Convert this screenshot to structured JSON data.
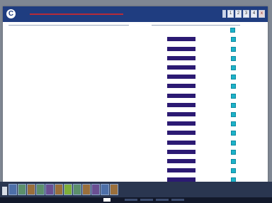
{
  "window": {
    "app_glyph": "C",
    "title_label": "",
    "title_buttons": [
      "",
      "1",
      "2",
      "3",
      "4",
      "x"
    ]
  },
  "header": {
    "label": "",
    "value": "",
    "check_color": "#1db2c9"
  },
  "rows": [
    {
      "label": "",
      "bar_text": "",
      "unit": "",
      "checked": true
    },
    {
      "label": "",
      "bar_text": "",
      "unit": "",
      "checked": true
    },
    {
      "label": "",
      "bar_text": "",
      "unit": "",
      "checked": true
    },
    {
      "label": "",
      "bar_text": "",
      "unit": "",
      "checked": true
    },
    {
      "label": "",
      "bar_text": "",
      "unit": "",
      "checked": true
    },
    {
      "label": "",
      "bar_text": "",
      "unit": "",
      "checked": true
    },
    {
      "label": "",
      "bar_text": "",
      "unit": "",
      "checked": true
    },
    {
      "label": "",
      "bar_text": "",
      "unit": "",
      "checked": true
    },
    {
      "label": "",
      "bar_text": "",
      "unit": "",
      "checked": true
    },
    {
      "label": "",
      "bar_text": "",
      "unit": "",
      "checked": true
    },
    {
      "label": "",
      "bar_text": "",
      "unit": "",
      "checked": true
    },
    {
      "label": "",
      "bar_text": "",
      "unit": "",
      "checked": true
    },
    {
      "label": "",
      "bar_text": "",
      "unit": "",
      "checked": true
    },
    {
      "label": "",
      "bar_text": "",
      "unit": "",
      "checked": true
    },
    {
      "label": "",
      "bar_text": "",
      "unit": "",
      "checked": true
    },
    {
      "label": "",
      "bar_text": "",
      "unit": "",
      "checked": true
    }
  ],
  "taskbar": {
    "icons": [
      "app-icon",
      "folder-icon",
      "browser-icon",
      "tool-icon",
      "chart-icon",
      "settings-icon",
      "media-icon",
      "edit-icon",
      "network-icon",
      "document-icon",
      "print-icon",
      "info-icon"
    ]
  },
  "colors": {
    "titlebar": "#1f3d80",
    "title_accent": "#b62b38",
    "value_bar": "#2c1a73",
    "checkbox": "#1db2c9",
    "taskbar": "#2a3650"
  }
}
